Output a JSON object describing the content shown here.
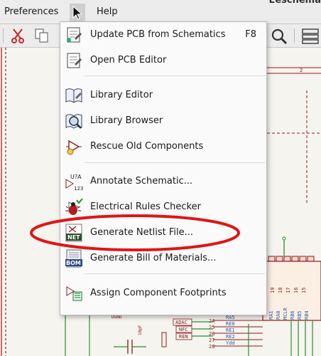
{
  "menubar": {
    "items": [
      {
        "label": "Preferences"
      },
      {
        "label": "Help"
      }
    ],
    "app_title": "Eeschema"
  },
  "tools_menu": {
    "items": [
      {
        "label": "Update PCB from Schematics",
        "shortcut": "F8",
        "icon": "update-pcb-icon"
      },
      {
        "label": "Open PCB Editor",
        "icon": "pcb-editor-icon"
      },
      {
        "label": "Library Editor",
        "icon": "library-editor-icon"
      },
      {
        "label": "Library Browser",
        "icon": "library-browser-icon"
      },
      {
        "label": "Rescue Old Components",
        "icon": "rescue-icon"
      },
      {
        "label": "Annotate Schematic...",
        "icon": "annotate-icon"
      },
      {
        "label": "Electrical Rules Checker",
        "icon": "erc-bug-icon"
      },
      {
        "label": "Generate Netlist File...",
        "icon": "netlist-icon",
        "highlighted_annotation": true
      },
      {
        "label": "Generate Bill of Materials...",
        "icon": "bom-icon"
      },
      {
        "label": "Assign Component Footprints",
        "icon": "footprint-icon"
      }
    ]
  },
  "schematic": {
    "sheet_marker": "2",
    "net_labels_left": [
      "ADAC",
      "NFC",
      "REN"
    ],
    "pin_numbers": [
      "24",
      "25",
      "26",
      "27",
      "28"
    ],
    "port_names": [
      "RA5",
      "RE0",
      "RE1",
      "RE2",
      "Ydd"
    ],
    "vertical_labels": [
      "RA1",
      "RA0",
      "MCLR",
      "RB6",
      "RB5",
      "RB4"
    ],
    "pin_numbers_top": [
      "20",
      "19",
      "18",
      "17",
      "16",
      "15"
    ],
    "component_value": "10pF",
    "ground_label": "DGND"
  },
  "colors": {
    "annotation_ellipse": "#e01515",
    "schematic_wire": "#2e8b2e",
    "schematic_part": "#8b1a1a",
    "schematic_border": "#a01818"
  }
}
